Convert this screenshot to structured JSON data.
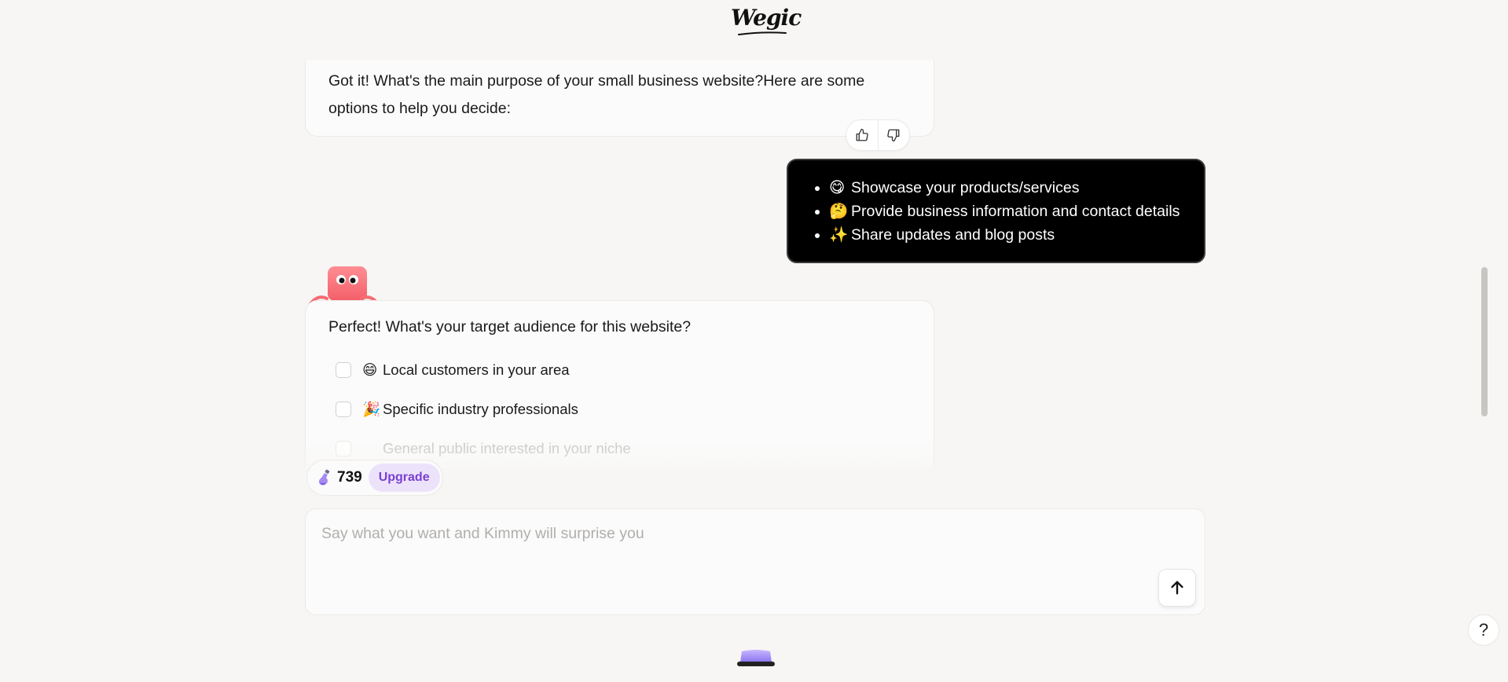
{
  "header": {
    "logo_text": "Wegic"
  },
  "messages": [
    {
      "role": "assistant",
      "text": "Got it! What's the main purpose of your small business website?Here are some options to help you decide:"
    },
    {
      "role": "user",
      "items": [
        {
          "emoji": "😋",
          "text": "Showcase your products/services"
        },
        {
          "emoji": "🤔",
          "text": "Provide business information and contact details"
        },
        {
          "emoji": "✨",
          "text": "Share updates and blog posts"
        }
      ]
    },
    {
      "role": "assistant",
      "question": "Perfect! What's your target audience for this website?",
      "options": [
        {
          "emoji": "😄",
          "text": "Local customers in your area"
        },
        {
          "emoji": "🎉",
          "text": "Specific industry professionals"
        },
        {
          "emoji": "",
          "text": "General public interested in your niche"
        }
      ]
    }
  ],
  "credits": {
    "count": "739",
    "upgrade_label": "Upgrade"
  },
  "composer": {
    "placeholder": "Say what you want and Kimmy will surprise you",
    "value": ""
  },
  "help": {
    "label": "?"
  },
  "colors": {
    "background": "#f7f6f4",
    "user_bubble": "#000000",
    "upgrade_bg": "#ece3fb",
    "upgrade_text": "#7b3fd3",
    "mascot": "#f76b73"
  },
  "icons": {
    "like": "thumbs-up-icon",
    "dislike": "thumbs-down-icon",
    "send": "arrow-up-icon",
    "credits": "potion-icon",
    "help": "question-mark-icon"
  }
}
